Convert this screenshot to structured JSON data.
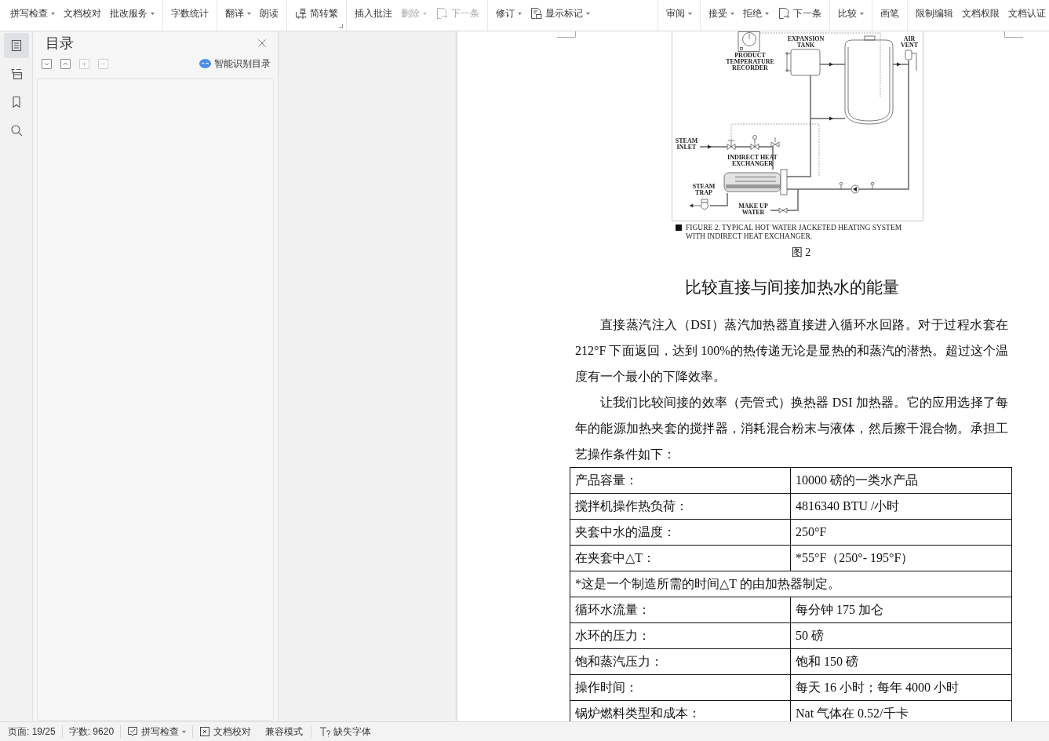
{
  "toolbar": {
    "groups": [
      {
        "items": [
          {
            "label": "拼写检查",
            "kind": "plain",
            "dropdown": true,
            "disabled": false
          },
          {
            "label": "文档校对",
            "kind": "plain",
            "dropdown": false,
            "disabled": false
          },
          {
            "label": "批改服务",
            "kind": "plain",
            "dropdown": true,
            "disabled": false
          }
        ]
      },
      {
        "items": [
          {
            "label": "字数统计",
            "kind": "plain",
            "dropdown": false,
            "disabled": false
          }
        ]
      },
      {
        "items": [
          {
            "label": "翻译",
            "kind": "plain",
            "dropdown": true,
            "disabled": false
          },
          {
            "label": "朗读",
            "kind": "plain",
            "dropdown": false,
            "disabled": false
          }
        ]
      },
      {
        "items": [
          {
            "label": "简转繁",
            "kind": "convert",
            "dropdown": false,
            "disabled": false
          }
        ],
        "launcher": true
      },
      {
        "items": [
          {
            "label": "插入批注",
            "kind": "plain",
            "dropdown": false,
            "disabled": false
          },
          {
            "label": "删除",
            "kind": "plain",
            "dropdown": true,
            "disabled": true
          },
          {
            "label": "下一条",
            "kind": "next",
            "dropdown": false,
            "disabled": true
          }
        ]
      },
      {
        "items": [
          {
            "label": "修订",
            "kind": "plain",
            "dropdown": true,
            "disabled": false
          },
          {
            "label": "显示标记",
            "kind": "markup",
            "dropdown": true,
            "disabled": false
          }
        ]
      },
      {
        "items": [
          {
            "label": "审阅",
            "kind": "plain",
            "dropdown": true,
            "disabled": false
          }
        ]
      },
      {
        "items": [
          {
            "label": "接受",
            "kind": "plain",
            "dropdown": true,
            "disabled": false
          },
          {
            "label": "拒绝",
            "kind": "plain",
            "dropdown": true,
            "disabled": false
          },
          {
            "label": "下一条",
            "kind": "next",
            "dropdown": false,
            "disabled": false
          }
        ]
      },
      {
        "items": [
          {
            "label": "比较",
            "kind": "plain",
            "dropdown": true,
            "disabled": false
          }
        ]
      },
      {
        "items": [
          {
            "label": "画笔",
            "kind": "plain",
            "dropdown": false,
            "disabled": false
          }
        ]
      },
      {
        "items": [
          {
            "label": "限制编辑",
            "kind": "plain",
            "dropdown": false,
            "disabled": false
          },
          {
            "label": "文档权限",
            "kind": "plain",
            "dropdown": false,
            "disabled": false
          },
          {
            "label": "文档认证",
            "kind": "plain",
            "dropdown": false,
            "disabled": false
          }
        ]
      }
    ]
  },
  "sidebar": {
    "rail": [
      {
        "kind": "contents",
        "selected": true
      },
      {
        "kind": "outline",
        "selected": false
      },
      {
        "kind": "bookmark",
        "selected": false
      },
      {
        "kind": "search",
        "selected": false
      }
    ],
    "panel": {
      "title": "目录",
      "controls": [
        {
          "kind": "down",
          "disabled": false
        },
        {
          "kind": "up",
          "disabled": false
        },
        {
          "kind": "plus",
          "disabled": true
        },
        {
          "kind": "minus",
          "disabled": true
        }
      ],
      "smart_link": "智能识别目录"
    }
  },
  "document": {
    "figure": {
      "labels": [
        {
          "kind": "recorder",
          "lines": [
            "PRODUCT",
            "TEMPERATURE",
            "RECORDER"
          ]
        },
        {
          "kind": "tank",
          "lines": [
            "EXPANSION",
            "TANK"
          ]
        },
        {
          "kind": "vent",
          "lines": [
            "AIR",
            "VENT"
          ]
        },
        {
          "kind": "inlet",
          "lines": [
            "STEAM",
            "INLET"
          ]
        },
        {
          "kind": "exchanger",
          "lines": [
            "INDIRECT HEAT",
            "EXCHANGER"
          ]
        },
        {
          "kind": "trap",
          "lines": [
            "STEAM",
            "TRAP"
          ]
        },
        {
          "kind": "makeup",
          "lines": [
            "MAKE UP",
            "WATER"
          ]
        }
      ],
      "caption": [
        "FIGURE 2. TYPICAL HOT WATER JACKETED HEATING SYSTEM",
        "WITH INDIRECT HEAT EXCHANGER."
      ]
    },
    "figure_number": "图 2",
    "heading": "比较直接与间接加热水的能量",
    "paragraphs": [
      "直接蒸汽注入（DSI）蒸汽加热器直接进入循环水回路。对于过程水套在 212°F 下面返回，达到 100%的热传递无论是显热的和蒸汽的潜热。超过这个温度有一个最小的下降效率。",
      "让我们比较间接的效率（壳管式）换热器 DSI 加热器。它的应用选择了每年的能源加热夹套的搅拌器，消耗混合粉末与液体，然后擦干混合物。承担工艺操作条件如下："
    ],
    "table": {
      "rows": [
        {
          "cells": [
            {
              "text": "产品容量："
            },
            {
              "text": "10000 磅的一类水产品"
            }
          ]
        },
        {
          "cells": [
            {
              "text": "搅拌机操作热负荷："
            },
            {
              "text": "4816340 BTU /小时"
            }
          ]
        },
        {
          "cells": [
            {
              "text": "夹套中水的温度："
            },
            {
              "text": "250°F"
            }
          ]
        },
        {
          "cells": [
            {
              "text": "在夹套中△T："
            },
            {
              "text": "*55°F（250°- 195°F）"
            }
          ]
        },
        {
          "cells": [
            {
              "text": "*这是一个制造所需的时间△T 的由加热器制定。",
              "colspan": 2
            }
          ]
        },
        {
          "cells": [
            {
              "text": "循环水流量："
            },
            {
              "text": "每分钟 175 加仑"
            }
          ]
        },
        {
          "cells": [
            {
              "text": "水环的压力："
            },
            {
              "text": "50 磅"
            }
          ]
        },
        {
          "cells": [
            {
              "text": "饱和蒸汽压力："
            },
            {
              "text": "饱和 150 磅"
            }
          ]
        },
        {
          "cells": [
            {
              "text": "操作时间："
            },
            {
              "text": "每天 16 小时；每年 4000 小时"
            }
          ]
        },
        {
          "cells": [
            {
              "text": "锅炉燃料类型和成本："
            },
            {
              "text": "Nat 气体在 0.52/千卡"
            }
          ]
        }
      ]
    }
  },
  "status_bar": {
    "items": [
      {
        "kind": "text",
        "label": "页面: 19/25",
        "dropdown": false
      },
      {
        "kind": "text",
        "label": "字数: 9620",
        "dropdown": false
      },
      {
        "kind": "spell",
        "label": "拼写检查",
        "dropdown": true
      },
      {
        "kind": "proofread",
        "label": "文档校对",
        "dropdown": false
      },
      {
        "kind": "text",
        "label": "兼容模式",
        "dropdown": false
      },
      {
        "kind": "font",
        "label": "缺失字体",
        "dropdown": false
      }
    ]
  }
}
